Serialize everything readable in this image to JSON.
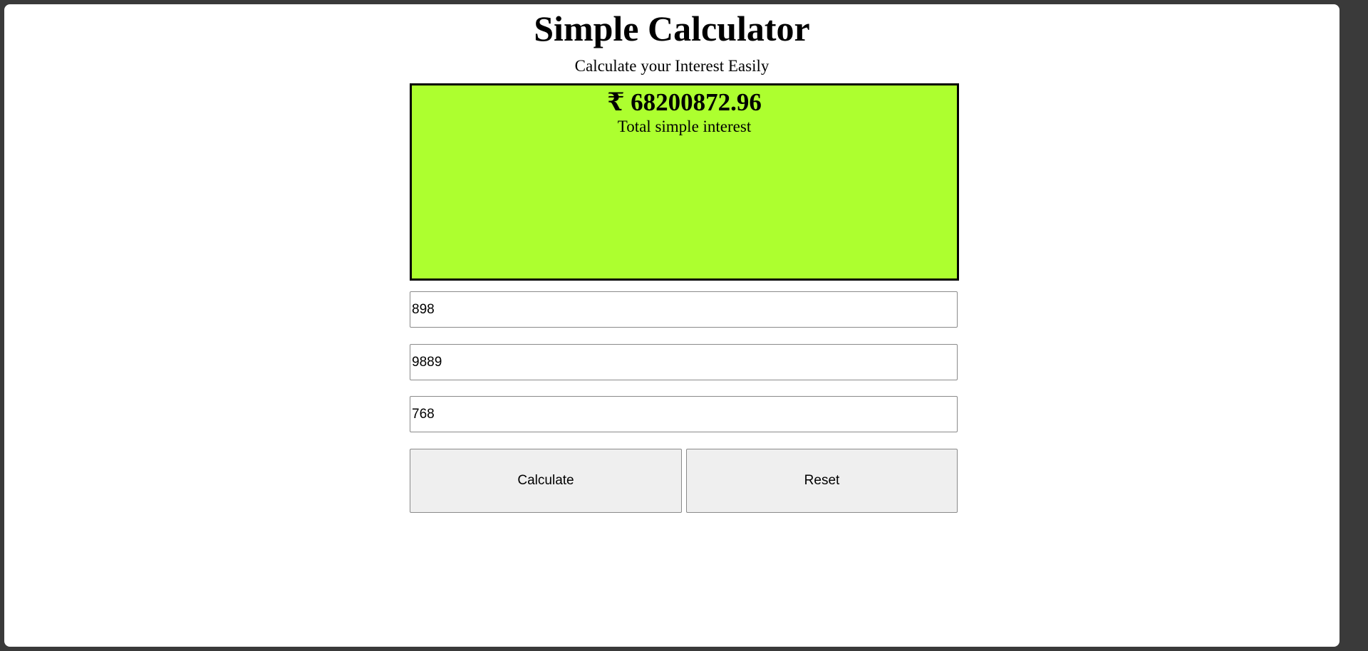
{
  "header": {
    "title": "Simple Calculator",
    "subtitle": "Calculate your Interest Easily"
  },
  "result": {
    "amount": "₹ 68200872.96",
    "label": "Total simple interest",
    "background_color": "#adff2f"
  },
  "inputs": {
    "principal_value": "898",
    "rate_value": "9889",
    "time_value": "768"
  },
  "buttons": {
    "calculate_label": "Calculate",
    "reset_label": "Reset"
  }
}
